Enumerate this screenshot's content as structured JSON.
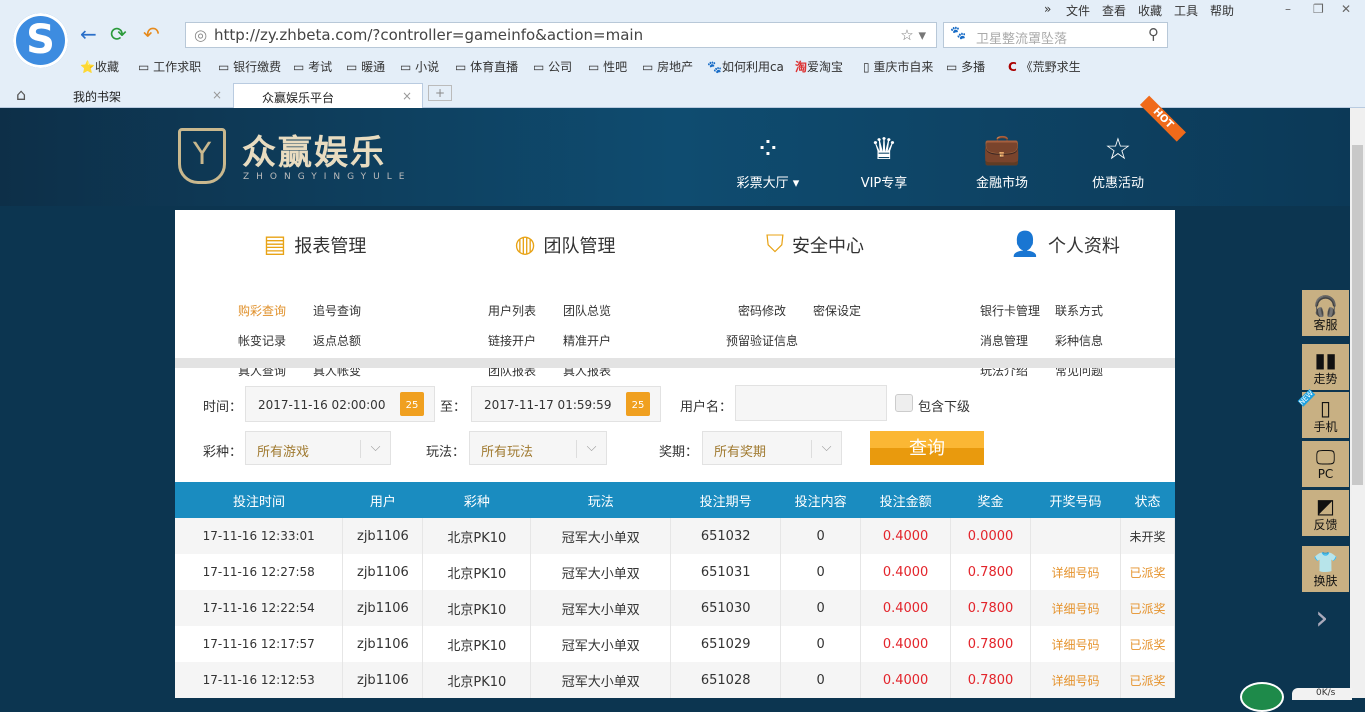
{
  "browser": {
    "url": "http://zy.zhbeta.com/?controller=gameinfo&action=main",
    "search_placeholder": "卫星整流罩坠落",
    "menu": [
      "»",
      "文件",
      "查看",
      "收藏",
      "工具",
      "帮助"
    ],
    "bookmarks": [
      "收藏",
      "工作求职",
      "银行缴费",
      "考试",
      "暖通",
      "小说",
      "体育直播",
      "公司",
      "性吧",
      "房地产",
      "如何利用ca",
      "爱淘宝",
      "重庆市自来",
      "多播",
      "《荒野求生"
    ],
    "tabs": [
      {
        "label": "我的书架"
      },
      {
        "label": "众赢娱乐平台"
      }
    ],
    "speed": "0K/s"
  },
  "header": {
    "brand": "众赢娱乐",
    "brand_sub": "ZHONGYINGYULE",
    "nav": [
      "彩票大厅",
      "VIP专享",
      "金融市场",
      "优惠活动"
    ],
    "hot": "HOT"
  },
  "sections": [
    {
      "title": "报表管理",
      "links": [
        "购彩查询",
        "追号查询",
        "帐变记录",
        "返点总额",
        "真人查询",
        "真人帐变"
      ]
    },
    {
      "title": "团队管理",
      "links": [
        "用户列表",
        "团队总览",
        "链接开户",
        "精准开户",
        "团队报表",
        "真人报表"
      ]
    },
    {
      "title": "安全中心",
      "links": [
        "密码修改",
        "密保设定",
        "预留验证信息"
      ]
    },
    {
      "title": "个人资料",
      "links": [
        "银行卡管理",
        "联系方式",
        "消息管理",
        "彩种信息",
        "玩法介绍",
        "常见问题"
      ]
    }
  ],
  "filter": {
    "time_label": "时间：",
    "start": "2017-11-16 02:00:00",
    "to_label": "至：",
    "end": "2017-11-17 01:59:59",
    "cal_day": "25",
    "user_label": "用户名：",
    "user_value": "",
    "include_label": "包含下级",
    "lottery_label": "彩种：",
    "lottery": "所有游戏",
    "play_label": "玩法：",
    "play": "所有玩法",
    "period_label": "奖期：",
    "period": "所有奖期",
    "query": "查询"
  },
  "table": {
    "headers": [
      "投注时间",
      "用户",
      "彩种",
      "玩法",
      "投注期号",
      "投注内容",
      "投注金额",
      "奖金",
      "开奖号码",
      "状态"
    ],
    "rows": [
      [
        "17-11-16 12:33:01",
        "zjb1106",
        "北京PK10",
        "冠军大小单双",
        "651032",
        "0",
        "0.4000",
        "0.0000",
        "",
        "未开奖"
      ],
      [
        "17-11-16 12:27:58",
        "zjb1106",
        "北京PK10",
        "冠军大小单双",
        "651031",
        "0",
        "0.4000",
        "0.7800",
        "详细号码",
        "已派奖"
      ],
      [
        "17-11-16 12:22:54",
        "zjb1106",
        "北京PK10",
        "冠军大小单双",
        "651030",
        "0",
        "0.4000",
        "0.7800",
        "详细号码",
        "已派奖"
      ],
      [
        "17-11-16 12:17:57",
        "zjb1106",
        "北京PK10",
        "冠军大小单双",
        "651029",
        "0",
        "0.4000",
        "0.7800",
        "详细号码",
        "已派奖"
      ],
      [
        "17-11-16 12:12:53",
        "zjb1106",
        "北京PK10",
        "冠军大小单双",
        "651028",
        "0",
        "0.4000",
        "0.7800",
        "详细号码",
        "已派奖"
      ]
    ]
  },
  "sidebar": [
    "客服",
    "走势",
    "手机",
    "PC",
    "反馈",
    "换肤"
  ],
  "sidebar_new": "NEW",
  "colors": {
    "accent": "#e8a316",
    "table_header": "#1a8cc0",
    "red": "#e3242b"
  }
}
